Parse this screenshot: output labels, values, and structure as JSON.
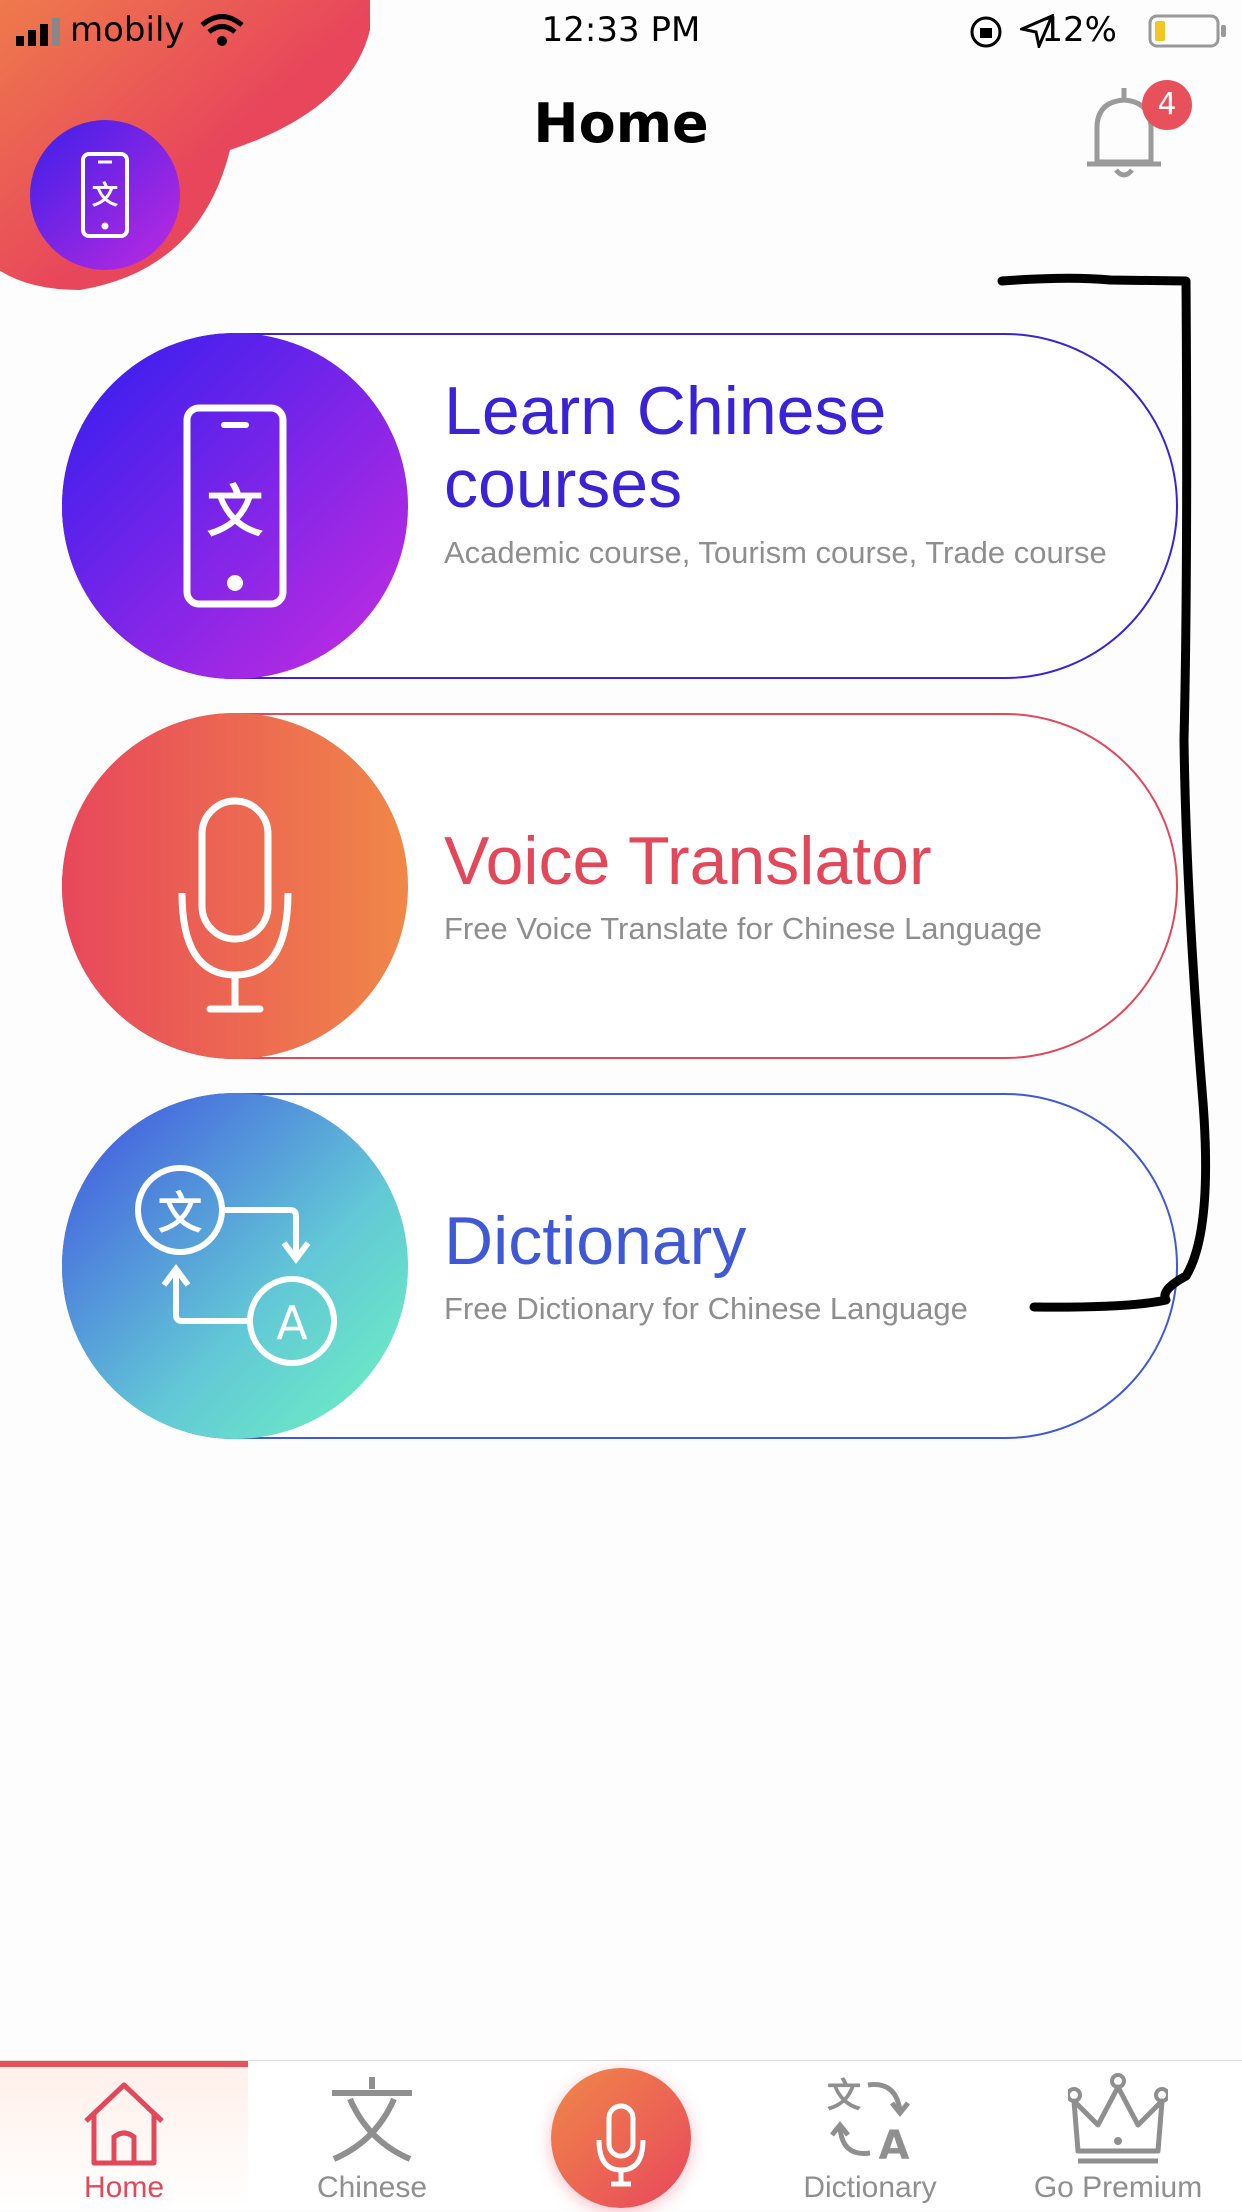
{
  "status_bar": {
    "carrier": "mobily",
    "time": "12:33 PM",
    "battery_percent": "12%"
  },
  "header": {
    "title": "Home",
    "notification_count": "4"
  },
  "cards": [
    {
      "title": "Learn Chinese courses",
      "subtitle": "Academic course, Tourism course, Trade course",
      "icon": "phone-translate-icon",
      "color": "#3a22d6"
    },
    {
      "title": "Voice Translator",
      "subtitle": "Free Voice Translate for Chinese Language",
      "icon": "microphone-icon",
      "color": "#e2475a"
    },
    {
      "title": "Dictionary",
      "subtitle": "Free Dictionary for Chinese Language",
      "icon": "translate-icon",
      "color": "#3f58d6"
    }
  ],
  "tab_bar": {
    "tabs": [
      {
        "label": "Home",
        "icon": "home-icon",
        "active": true
      },
      {
        "label": "Chinese",
        "icon": "chinese-character-icon",
        "active": false
      },
      {
        "label": "",
        "icon": "microphone-icon",
        "active": false
      },
      {
        "label": "Dictionary",
        "icon": "translate-icon",
        "active": false
      },
      {
        "label": "Go Premium",
        "icon": "crown-icon",
        "active": false
      }
    ]
  },
  "colors": {
    "accent_red": "#e8505b",
    "accent_purple": "#3a22d6",
    "accent_blue": "#3f58d6"
  }
}
